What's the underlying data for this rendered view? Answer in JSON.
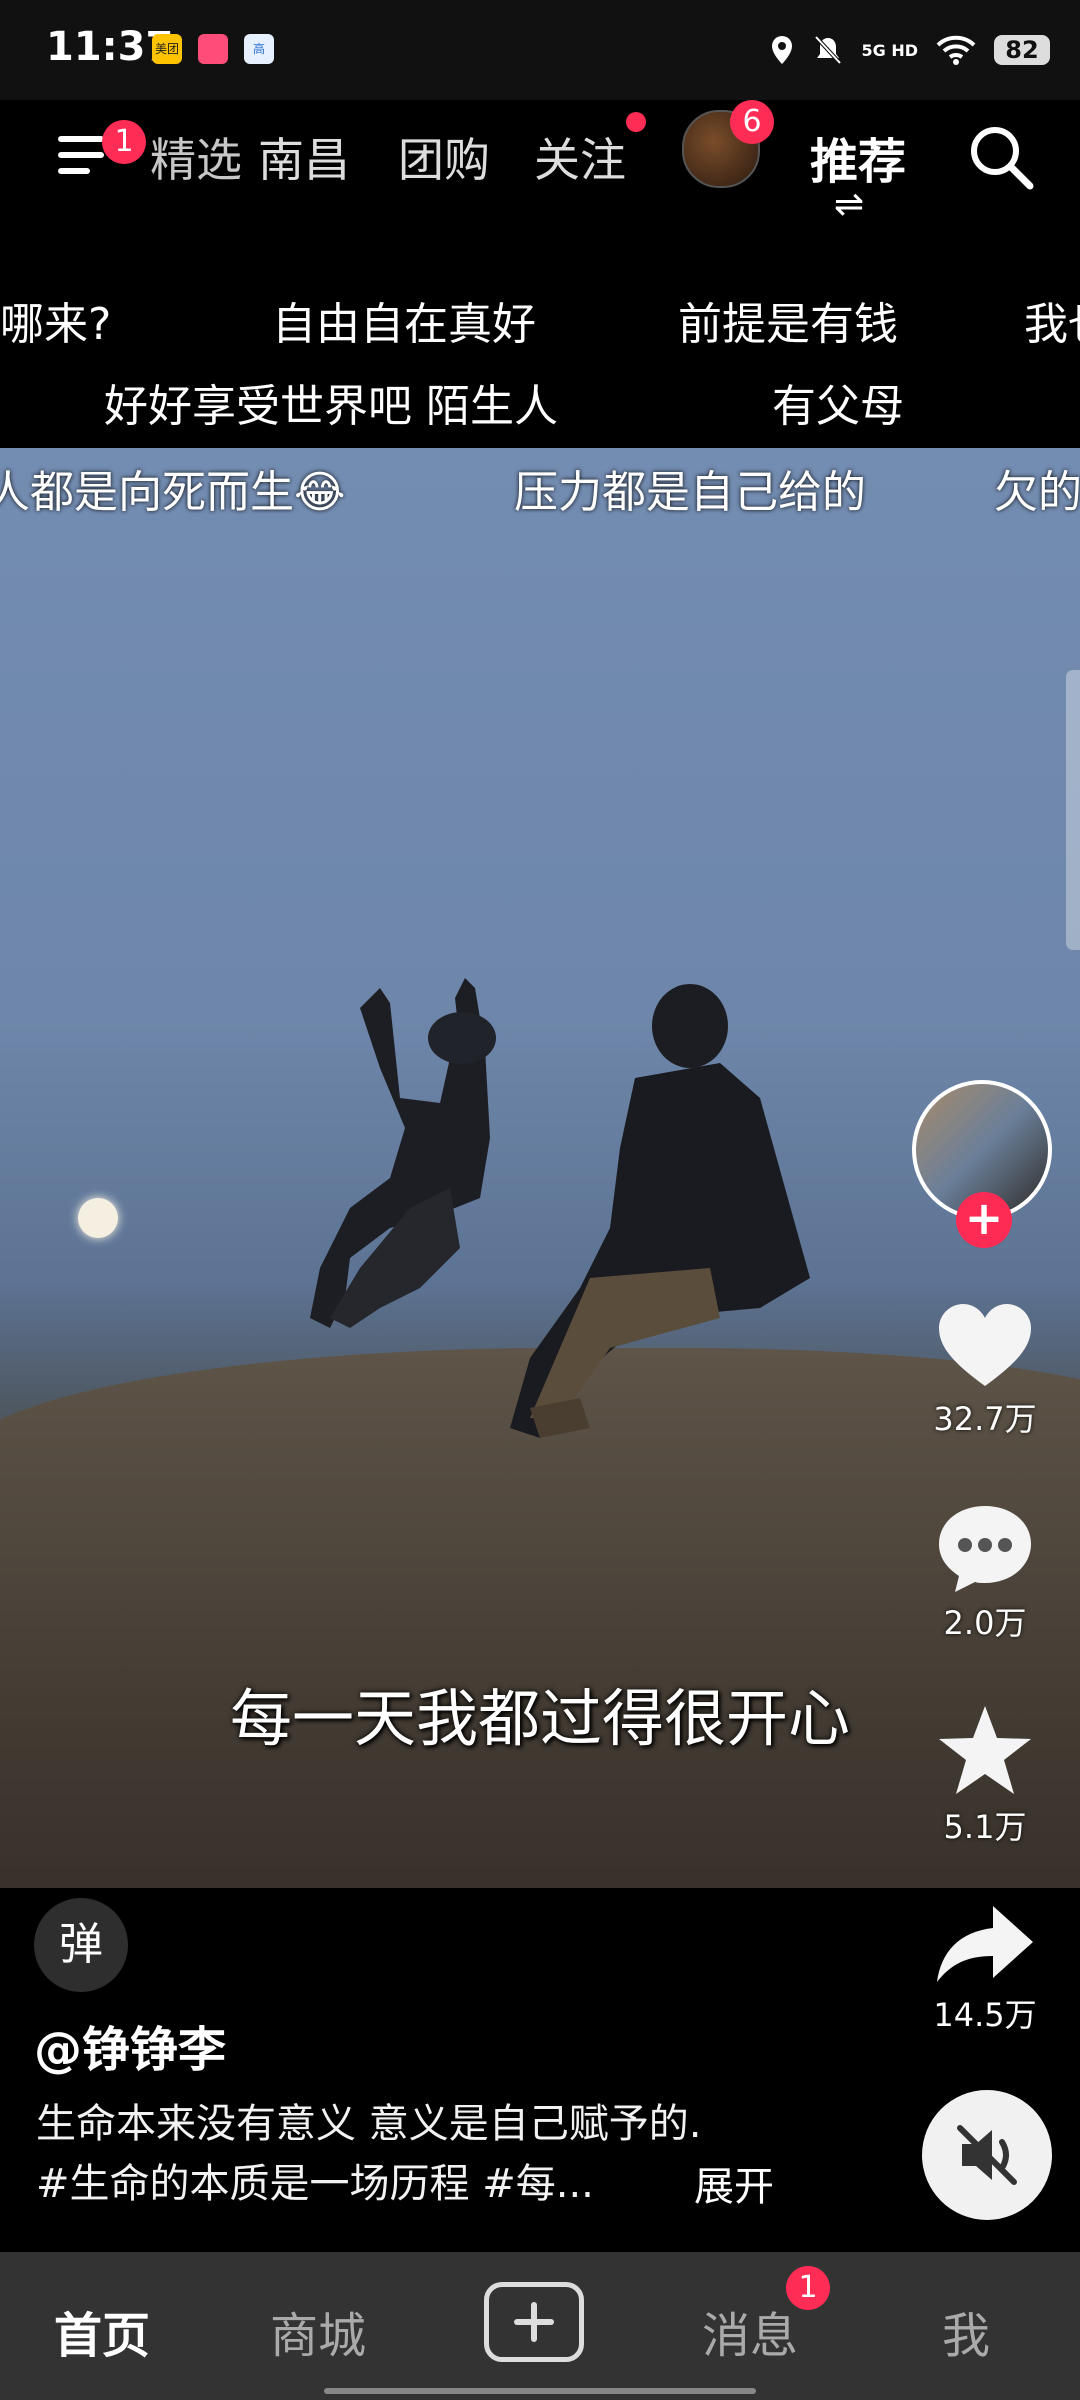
{
  "status_bar": {
    "time": "11:37",
    "app_icons": [
      "美团",
      "",
      "高"
    ],
    "network": "5G HD",
    "battery": "82"
  },
  "top_nav": {
    "menu_badge": "1",
    "tabs": [
      {
        "label": "精选"
      },
      {
        "label": "南昌"
      },
      {
        "label": "团购"
      },
      {
        "label": "关注"
      }
    ],
    "live_badge": "6",
    "active_tab": "推荐",
    "swap_icon": "⇌"
  },
  "danmaku": {
    "row1": [
      "哪来?",
      "自由自在真好",
      "前提是有钱",
      "我也"
    ],
    "row2": [
      "好好享受世界吧 陌生人",
      "有父母"
    ],
    "row3": [
      "人都是向死而生😂",
      "压力都是自己给的",
      "欠的"
    ]
  },
  "video": {
    "subtitle": "每一天我都过得很开心"
  },
  "actions": {
    "like_count": "32.7万",
    "comment_count": "2.0万",
    "favorite_count": "5.1万",
    "share_count": "14.5万"
  },
  "post": {
    "danmaku_btn": "弹",
    "author": "@铮铮李",
    "desc_line1": "生命本来没有意义 意义是自己赋予的.",
    "desc_line2": "#生命的本质是一场历程 #每...",
    "expand": "展开"
  },
  "bottom_nav": {
    "home": "首页",
    "shop": "商城",
    "messages": "消息",
    "messages_badge": "1",
    "me": "我"
  },
  "colors": {
    "accent": "#fe2c55",
    "nav_bg": "#333333"
  }
}
